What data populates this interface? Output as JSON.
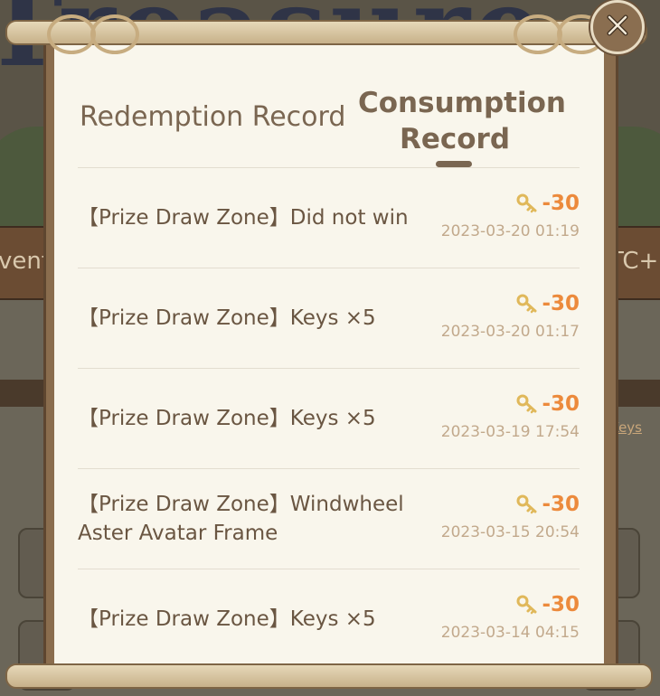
{
  "background": {
    "banner_left_text": "vent",
    "banner_right_text": "TC+",
    "keys_link": "Keys"
  },
  "tabs": {
    "redemption_label": "Redemption Record",
    "consumption_line1": "Consumption",
    "consumption_line2": "Record",
    "active": "consumption"
  },
  "records": [
    {
      "description": "【Prize Draw Zone】Did not win",
      "amount": "-30",
      "time": "2023-03-20 01:19",
      "icon": "key-icon"
    },
    {
      "description": "【Prize Draw Zone】Keys ×5",
      "amount": "-30",
      "time": "2023-03-20 01:17",
      "icon": "key-icon"
    },
    {
      "description": "【Prize Draw Zone】Keys ×5",
      "amount": "-30",
      "time": "2023-03-19 17:54",
      "icon": "key-icon"
    },
    {
      "description": "【Prize Draw Zone】Windwheel Aster Avatar Frame",
      "amount": "-30",
      "time": "2023-03-15 20:54",
      "icon": "key-icon"
    },
    {
      "description": "【Prize Draw Zone】Keys ×5",
      "amount": "-30",
      "time": "2023-03-14 04:15",
      "icon": "key-icon"
    }
  ],
  "colors": {
    "amount": "#ec8a3c",
    "text": "#6a5642",
    "timestamp": "#c2a98c",
    "paper": "#f9f6ec"
  },
  "close_icon": "close-icon"
}
